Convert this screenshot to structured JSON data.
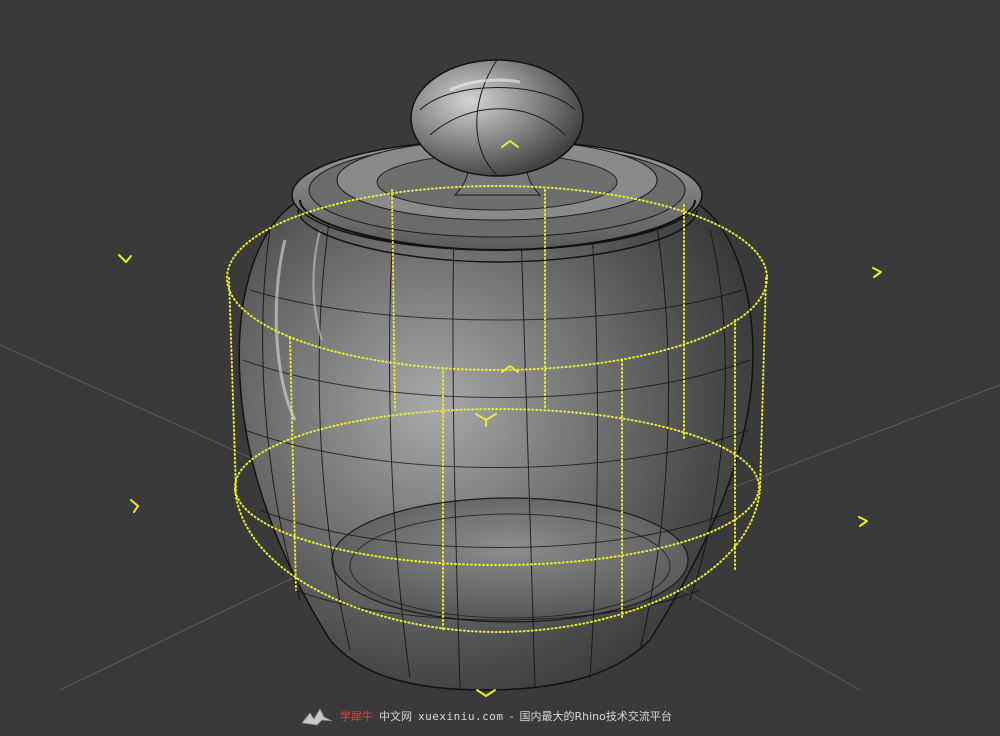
{
  "viewport": {
    "background": "#3a3a3a",
    "gizmo_color": "#ecec2e",
    "gridline_color": "#5b5b5b",
    "display_mode": "ghosted",
    "selection": "cage-edit control points"
  },
  "watermark": {
    "logo_icon": "crane-logo-icon",
    "brand": "学犀牛",
    "brand_suffix": "中文网",
    "site": "xuexiniu.com",
    "dash": "-",
    "slogan": "国内最大的Rhino技术交流平台"
  }
}
